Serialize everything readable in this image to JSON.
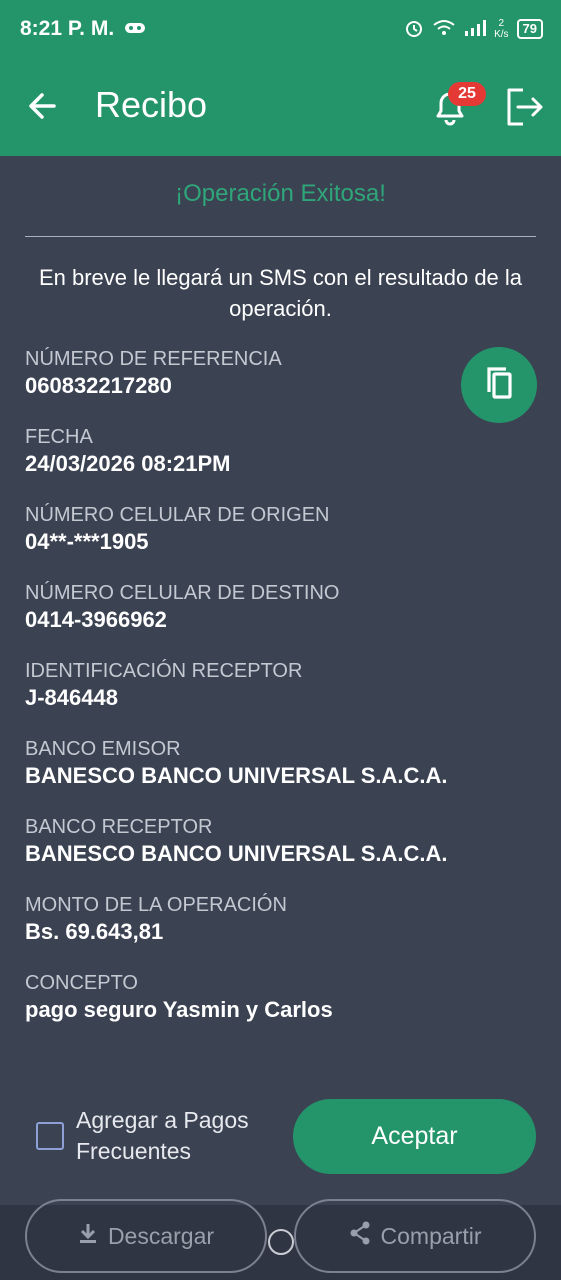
{
  "status_bar": {
    "time": "8:21 P. M.",
    "net_speed_top": "2",
    "net_speed_unit": "K/s",
    "battery": "79"
  },
  "app_bar": {
    "title": "Recibo",
    "notification_count": "25"
  },
  "receipt": {
    "success_title": "¡Operación Exitosa!",
    "sms_message": "En breve le llegará un SMS con el resultado de la operación.",
    "fields": [
      {
        "label": "NÚMERO DE REFERENCIA",
        "value": "060832217280"
      },
      {
        "label": "FECHA",
        "value": "24/03/2026 08:21PM"
      },
      {
        "label": "NÚMERO CELULAR DE ORIGEN",
        "value": "04**-***1905"
      },
      {
        "label": "NÚMERO CELULAR DE DESTINO",
        "value": "0414-3966962"
      },
      {
        "label": "IDENTIFICACIÓN RECEPTOR",
        "value": "J-846448"
      },
      {
        "label": "BANCO EMISOR",
        "value": "BANESCO BANCO UNIVERSAL S.A.C.A."
      },
      {
        "label": "BANCO RECEPTOR",
        "value": "BANESCO BANCO UNIVERSAL S.A.C.A."
      },
      {
        "label": "MONTO DE LA OPERACIÓN",
        "value": "Bs. 69.643,81"
      },
      {
        "label": "CONCEPTO",
        "value": "pago seguro Yasmin y Carlos"
      }
    ]
  },
  "actions": {
    "frequent_label": "Agregar a Pagos Frecuentes",
    "accept_label": "Aceptar",
    "download_label": "Descargar",
    "share_label": "Compartir"
  },
  "colors": {
    "primary": "#24956b",
    "background": "#3b4252",
    "success_text": "#2fa679",
    "badge": "#e53935"
  }
}
